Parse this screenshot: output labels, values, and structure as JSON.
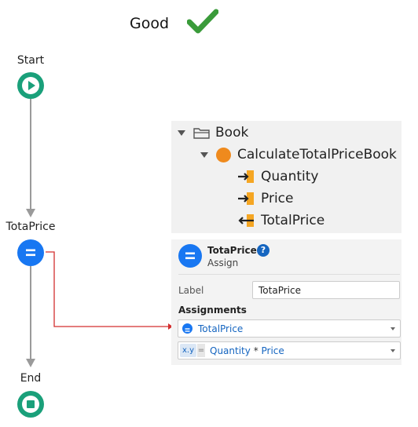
{
  "header": {
    "verdict": "Good",
    "verdict_icon": "check-icon",
    "check_color": "#3a9b3a"
  },
  "flow": {
    "start_label": "Start",
    "assign_label": "TotaPrice",
    "end_label": "End",
    "start_color": "#1aa07a",
    "assign_color": "#1877f2",
    "end_color": "#1aa07a",
    "connector_color": "#d32f2f"
  },
  "tree": {
    "items": [
      {
        "label": "Book",
        "icon": "folder-icon"
      },
      {
        "label": "CalculateTotalPriceBook",
        "icon": "action-circle-icon",
        "icon_color": "#ef8a1d"
      },
      {
        "label": "Quantity",
        "icon": "input-parameter-icon"
      },
      {
        "label": "Price",
        "icon": "input-parameter-icon"
      },
      {
        "label": "TotalPrice",
        "icon": "output-parameter-icon"
      }
    ]
  },
  "properties": {
    "title": "TotaPrice",
    "subtitle": "Assign",
    "help": "?",
    "label_caption": "Label",
    "label_value": "TotaPrice",
    "assignments_heading": "Assignments",
    "variable": "TotalPrice",
    "xy_badge": "x.y",
    "equals": "=",
    "expr_left": "Quantity",
    "expr_op": "*",
    "expr_right": "Price"
  }
}
